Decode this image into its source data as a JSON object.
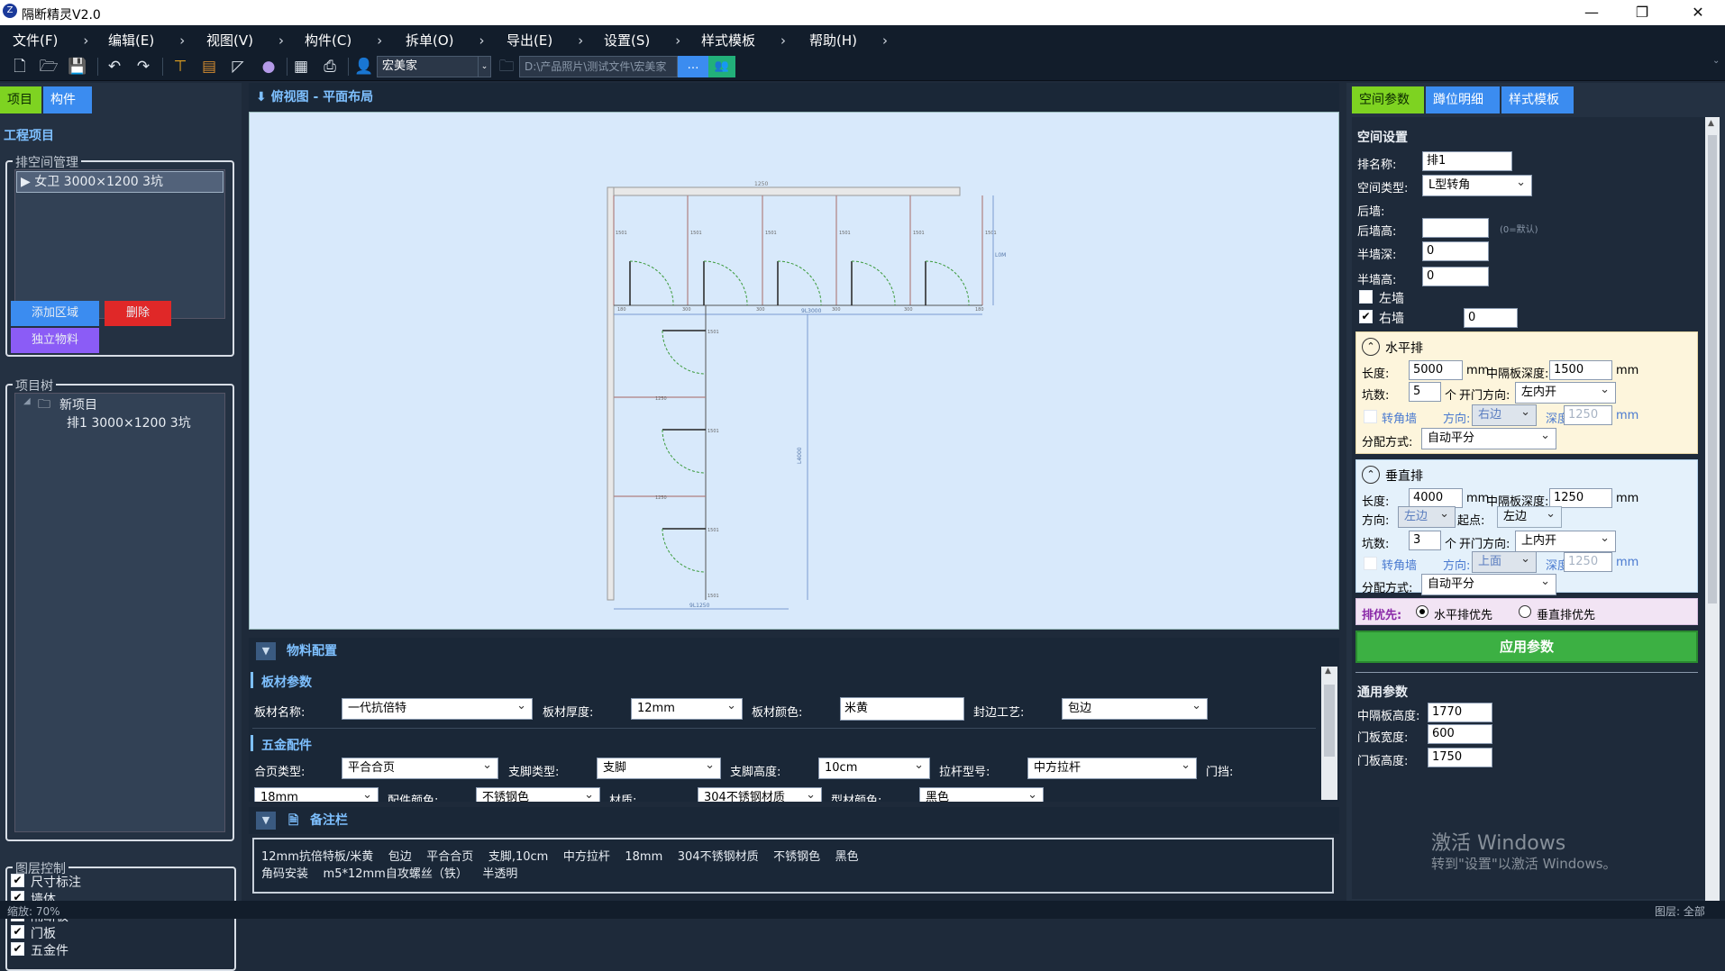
{
  "app": {
    "title": "隔断精灵V2.0",
    "icon": "Z"
  },
  "window": {
    "min": "—",
    "max": "❐",
    "close": "✕"
  },
  "menu": [
    "文件(F)",
    "编辑(E)",
    "视图(V)",
    "构件(C)",
    "拆单(O)",
    "导出(E)",
    "设置(S)",
    "样式模板",
    "帮助(H)"
  ],
  "toolbar": {
    "user": "宏美家",
    "path": "D:\\产品照片\\测试文件\\宏美家",
    "more": "…"
  },
  "left": {
    "tabs": [
      "项目",
      "构件"
    ],
    "section_title": "工程项目",
    "space_group": "排空间管理",
    "space_item": "▶ 女卫  3000×1200  3坑",
    "btn_add": "添加区域",
    "btn_del": "删除",
    "btn_material": "独立物料",
    "tree_group": "项目树",
    "tree_root": "新项目",
    "tree_child": "排1  3000×1200  3坑",
    "layer_group": "图层控制",
    "layers": [
      "尺寸标注",
      "墙体",
      "隔断板",
      "门板",
      "五金件"
    ]
  },
  "center": {
    "view_title": "⬇ 俯视图 - 平面布局",
    "material_title": "物料配置",
    "board_title": "板材参数",
    "board_name_lbl": "板材名称:",
    "board_name": "一代抗倍特",
    "board_thick_lbl": "板材厚度:",
    "board_thick": "12mm",
    "board_color_lbl": "板材颜色:",
    "board_color": "米黄",
    "edge_lbl": "封边工艺:",
    "edge": "包边",
    "hw_title": "五金配件",
    "hinge_lbl": "合页类型:",
    "hinge": "平合合页",
    "leg_lbl": "支脚类型:",
    "leg": "支脚",
    "leg_h_lbl": "支脚高度:",
    "leg_h": "10cm",
    "bar_lbl": "拉杆型号:",
    "bar": "中方拉杆",
    "stop_lbl": "门挡:",
    "row2a": "18mm",
    "row2b_lbl": "配件颜色:",
    "row2b": "不锈钢色",
    "row2c_lbl": "材质:",
    "row2c": "304不锈钢材质",
    "row2d_lbl": "型材颜色:",
    "row2d": "黑色",
    "notes_title": "备注栏",
    "notes_line1": "12mm抗倍特板/米黄    包边    平合合页    支脚,10cm    中方拉杆    18mm    304不锈钢材质    不锈钢色    黑色",
    "notes_line2": "角码安装    m5*12mm自攻螺丝（铁）    半透明"
  },
  "drawing": {
    "top_dim": "1250",
    "mid_dim": "9L3000",
    "right_dim": "L0M",
    "vert_dim": "L4000",
    "bottom_dim": "9L1250",
    "seg_labels": [
      "180",
      "300",
      "300",
      "300",
      "300",
      "180"
    ],
    "stall_dim": "1250",
    "depth_label": "1500"
  },
  "right": {
    "tabs": [
      "空间参数",
      "蹲位明细",
      "样式模板"
    ],
    "section": "空间设置",
    "row_name_lbl": "排名称:",
    "row_name": "排1",
    "space_type_lbl": "空间类型:",
    "space_type": "L型转角",
    "back_wall_lbl": "后墙:",
    "back_h_lbl": "后墙高:",
    "back_h": "",
    "back_h_hint": "(0=默认)",
    "half_depth_lbl": "半墙深:",
    "half_depth": "0",
    "half_h_lbl": "半墙高:",
    "half_h": "0",
    "left_wall": "左墙",
    "right_wall": "右墙",
    "right_wall_val": "0",
    "h": {
      "title": "水平排",
      "len_lbl": "长度:",
      "len": "5000",
      "unit": "mm",
      "mid_depth_lbl": "中隔板深度:",
      "mid_depth": "1500",
      "pits_lbl": "坑数:",
      "pits": "5",
      "pits_unit": "个",
      "door_dir_lbl": "开门方向:",
      "door_dir": "左内开",
      "corner_lbl": "转角墙",
      "dir_lbl": "方向:",
      "dir": "右边",
      "depth_lbl": "深度:",
      "depth": "1250",
      "alloc_lbl": "分配方式:",
      "alloc": "自动平分"
    },
    "v": {
      "title": "垂直排",
      "len_lbl": "长度:",
      "len": "4000",
      "unit": "mm",
      "mid_depth_lbl": "中隔板深度:",
      "mid_depth": "1250",
      "dir_lbl": "方向:",
      "dir": "左边",
      "start_lbl": "起点:",
      "start": "左边",
      "pits_lbl": "坑数:",
      "pits": "3",
      "pits_unit": "个",
      "door_dir_lbl": "开门方向:",
      "door_dir": "上内开",
      "corner_lbl": "转角墙",
      "cdir_lbl": "方向:",
      "cdir": "上面",
      "depth_lbl": "深度:",
      "depth": "1250",
      "alloc_lbl": "分配方式:",
      "alloc": "自动平分"
    },
    "priority_lbl": "排优先:",
    "prio_h": "水平排优先",
    "prio_v": "垂直排优先",
    "apply": "应用参数",
    "common": "通用参数",
    "mid_h_lbl": "中隔板高度:",
    "mid_h": "1770",
    "door_w_lbl": "门板宽度:",
    "door_w": "600",
    "door_h_lbl": "门板高度:",
    "door_h": "1750"
  },
  "watermark": {
    "line1": "激活 Windows",
    "line2": "转到\"设置\"以激活 Windows。"
  },
  "status": {
    "zoom": "缩放: 70%",
    "layer": "图层: 全部"
  },
  "colors": {
    "green": "#7ed321",
    "blue": "#3b8cf0",
    "red": "#e02828",
    "purple": "#8b5cf6",
    "apply": "#3cb043"
  }
}
